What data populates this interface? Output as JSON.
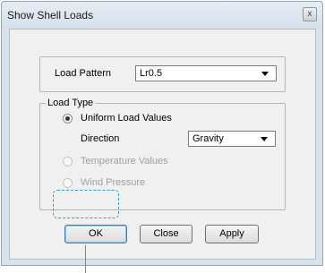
{
  "window": {
    "title": "Show Shell Loads",
    "close_label": "x"
  },
  "load_pattern": {
    "label": "Load Pattern",
    "value": "Lr0.5"
  },
  "load_type": {
    "group_label": "Load Type",
    "uniform": {
      "label": "Uniform Load Values",
      "checked": true
    },
    "direction": {
      "label": "Direction",
      "value": "Gravity"
    },
    "temperature": {
      "label": "Temperature Values",
      "enabled": false
    },
    "wind": {
      "label": "Wind Pressure",
      "enabled": false
    }
  },
  "buttons": {
    "ok": "OK",
    "close": "Close",
    "apply": "Apply"
  },
  "colors": {
    "focus_highlight": "#3399dd",
    "dialog_bg": "#f0f0f0",
    "frame": "#d7e2ec"
  }
}
